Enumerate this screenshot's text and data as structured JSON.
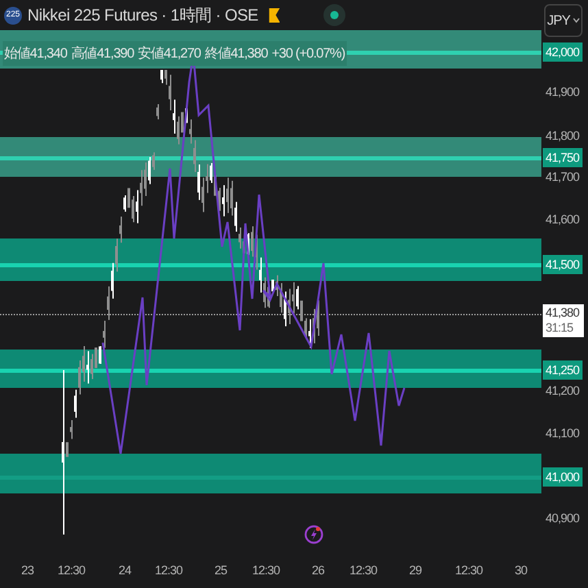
{
  "header": {
    "symbol_badge": "225",
    "title": "Nikkei 225 Futures · 1時間 · OSE",
    "currency": "JPY"
  },
  "ohlc": [
    {
      "label": "始値",
      "value": "41,340"
    },
    {
      "label": "高値",
      "value": "41,390"
    },
    {
      "label": "安値",
      "value": "41,270"
    },
    {
      "label": "終値",
      "value": "41,380"
    }
  ],
  "change": "+30 (+0.07%)",
  "zones": [
    {
      "label": "42,000",
      "kind": "grey"
    },
    {
      "label": "41,750",
      "kind": "grey"
    },
    {
      "label": "41,500",
      "kind": "green"
    },
    {
      "label": "41,250",
      "kind": "green"
    },
    {
      "label": "41,000",
      "kind": "green"
    }
  ],
  "price_axis": [
    "41,900",
    "41,800",
    "41,700",
    "41,600",
    "41,200",
    "41,100",
    "40,900"
  ],
  "last_price": {
    "price": "41,380",
    "countdown": "31:15"
  },
  "time_axis": [
    "23",
    "12:30",
    "24",
    "12:30",
    "25",
    "12:30",
    "26",
    "12:30",
    "29",
    "12:30",
    "30"
  ]
}
